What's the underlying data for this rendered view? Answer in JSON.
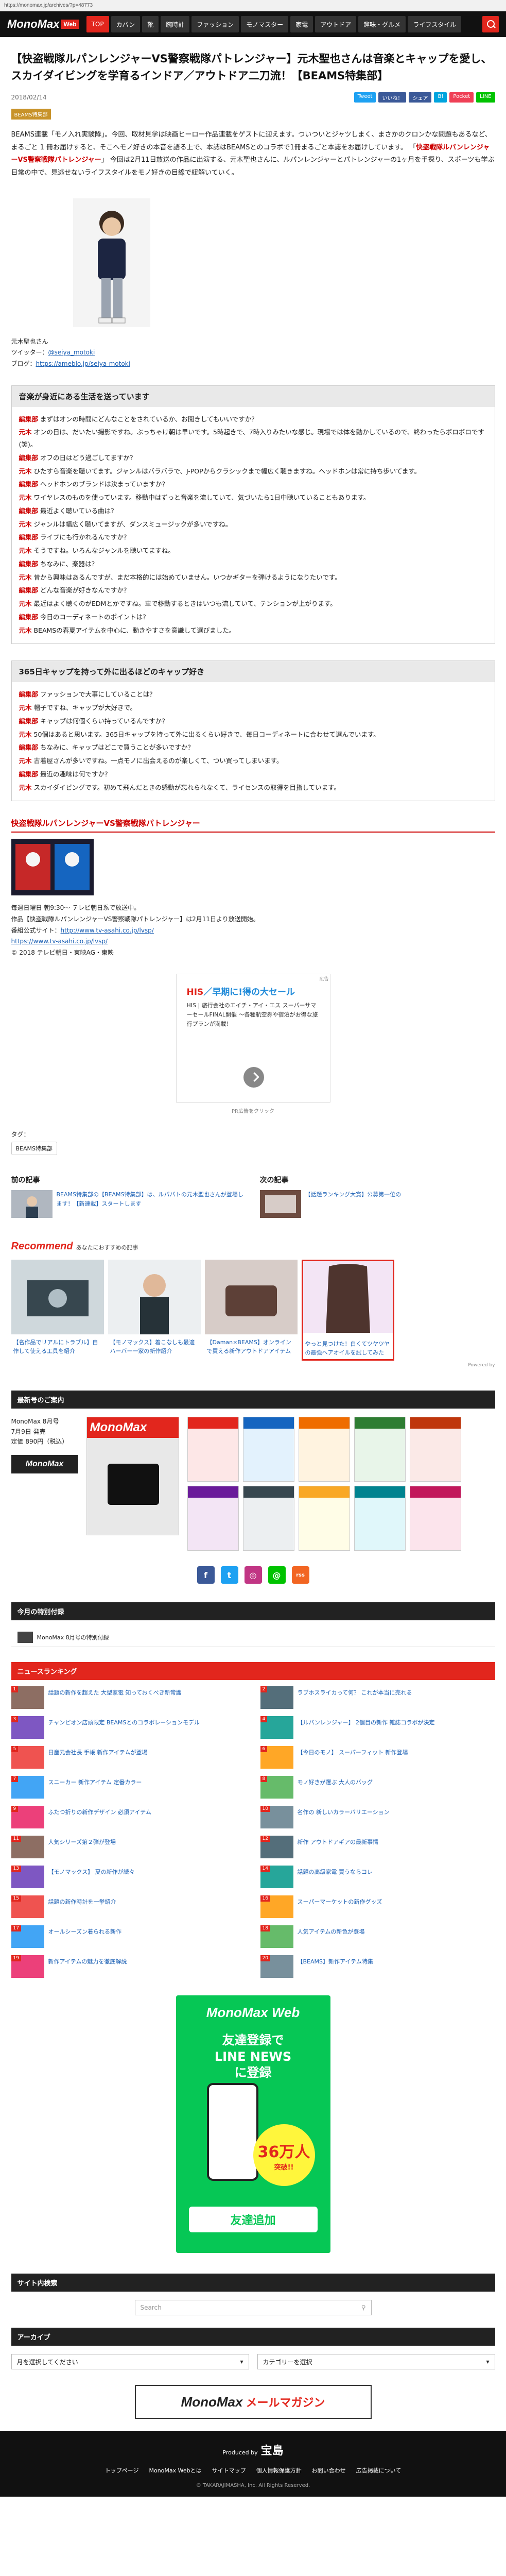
{
  "browser": {
    "url": "https://monomax.jp/archives/?p=48773"
  },
  "nav": {
    "logo": "MonoMax",
    "logo_web": "Web",
    "items": [
      "TOP",
      "カバン",
      "靴",
      "腕時計",
      "ファッション",
      "モノマスター",
      "家電",
      "アウトドア",
      "趣味・グルメ",
      "ライフスタイル"
    ]
  },
  "article": {
    "title": "【快盗戦隊ルパンレンジャーVS警察戦隊パトレンジャー】元木聖也さんは音楽とキャップを愛し、スカイダイビングを学育るインドア／アウトドア二刀流！【BEAMS特集部】",
    "date": "2018/02/14",
    "share": [
      "Tweet",
      "いいね！",
      "シェア",
      "B!",
      "Pocket",
      "LINE"
    ],
    "category": "BEAMS特集部",
    "intro": "BEAMS連載「モノ入れ実験隊」。今回、取材見学は映画ヒーロー作品連載をゲストに迎えます。ついついとジャツしまく、まさかのクロンかな問題もあるなど、まるごと 1 冊お届けすると、そこへモノ好きの本音を語る上で、本誌はBEAMSとのコラボで1冊まるごと本誌をお届けしています。",
    "intro_bold": "快盗戦隊ルパンレンジャーVS警察戦隊パトレンジャー",
    "intro2": "今回は2月11日放送の作品に出演する、元木聖也さんに、ルパンレンジャーとパトレンジャーの1ヶ月を手探り、スポーツも学ぶ日常の中で、見逃せないライフスタイルをモノ好きの目線で紐解いていく。",
    "profile_name": "元木聖也さん",
    "profile_twitter_label": "ツイッター：",
    "profile_twitter": "@seiya_motoki",
    "profile_blog_label": "ブログ：",
    "profile_blog": "https://ameblo.jp/seiya-motoki"
  },
  "section1": {
    "heading": "音楽が身近にある生活を送っています",
    "lines": [
      [
        "編集部",
        "まずはオンの時間にどんなことをされているか、お聞きしてもいいですか？"
      ],
      [
        "元木",
        "オンの日は、だいたい撮影ですね。ぶっちゃけ朝は早いです。5時起きで、7時入りみたいな感じ。現場では体を動かしているので、終わったらボロボロです(笑)。"
      ],
      [
        "編集部",
        "オフの日はどう過ごしてますか？"
      ],
      [
        "元木",
        "ひたすら音楽を聴いてます。ジャンルはバラバラで、J-POPからクラシックまで幅広く聴きますね。ヘッドホンは常に持ち歩いてます。"
      ],
      [
        "編集部",
        "ヘッドホンのブランドは決まっていますか？"
      ],
      [
        "元木",
        "ワイヤレスのものを使っています。移動中はずっと音楽を流していて、気づいたら1日中聴いていることもあります。"
      ],
      [
        "編集部",
        "最近よく聴いている曲は？"
      ],
      [
        "元木",
        "ジャンルは幅広く聴いてますが、ダンスミュージックが多いですね。"
      ],
      [
        "編集部",
        "ライブにも行かれるんですか？"
      ],
      [
        "元木",
        "そうですね。いろんなジャンルを聴いてますね。"
      ],
      [
        "編集部",
        "ちなみに、楽器は？"
      ],
      [
        "元木",
        "昔から興味はあるんですが、まだ本格的には始めていません。いつかギターを弾けるようになりたいです。"
      ],
      [
        "編集部",
        "どんな音楽が好きなんですか？"
      ],
      [
        "元木",
        "最近はよく聴くのがEDMとかですね。車で移動するときはいつも流していて、テンションが上がります。"
      ],
      [
        "編集部",
        "今日のコーディネートのポイントは？"
      ],
      [
        "元木",
        "BEAMSの春夏アイテムを中心に、動きやすさを意識して選びました。"
      ]
    ]
  },
  "section2": {
    "heading": "365日キャップを持って外に出るほどのキャップ好き",
    "lines": [
      [
        "編集部",
        "ファッションで大事にしていることは？"
      ],
      [
        "元木",
        "帽子ですね、キャップが大好きで。"
      ],
      [
        "編集部",
        "キャップは何個くらい持っているんですか？"
      ],
      [
        "元木",
        "50個はあると思います。365日キャップを持って外に出るくらい好きで、毎日コーディネートに合わせて選んでいます。"
      ],
      [
        "編集部",
        "ちなみに、キャップはどこで買うことが多いですか？"
      ],
      [
        "元木",
        "古着屋さんが多いですね。一点モノに出会えるのが楽しくて、つい買ってしまいます。"
      ],
      [
        "編集部",
        "最近の趣味は何ですか？"
      ],
      [
        "元木",
        "スカイダイビングです。初めて飛んだときの感動が忘れられなくて、ライセンスの取得を目指しています。"
      ]
    ]
  },
  "vs": {
    "heading": "快盗戦隊ルパンレンジャーVS警察戦隊パトレンジャー",
    "lines": [
      "毎週日曜日 朝9:30～ テレビ朝日系で放送中。",
      "作品【快盗戦隊ルパンレンジャーVS警察戦隊パトレンジャー】は2月11日より放送開始。",
      "番組公式サイト：",
      "https://www.tv-asahi.co.jp/lvsp/",
      "© 2018 テレビ朝日・東映AG・東映"
    ],
    "site_link": "http://www.tv-asahi.co.jp/lvsp/"
  },
  "ad": {
    "label": "広告",
    "title1": "HIS",
    "title2": "／早期に!得の大セール",
    "sub": "HIS | 旅行会社のエイチ・アイ・エス スーパーサマーセールFINAL開催 ～各種航空券や宿泊がお得な旅行プランが満載！",
    "note": "PR広告をクリック"
  },
  "tags": {
    "label": "タグ：",
    "items": [
      "BEAMS特集部"
    ]
  },
  "prev_next": {
    "prev_heading": "前の記事",
    "prev_text": "BEAMS特集部の【BEAMS特集部】は、ルパパトの元木聖也さんが登場します！【新連載】スタートします",
    "next_heading": "次の記事",
    "next_text": "【話題ランキング大賞】公募第一位の"
  },
  "recommend": {
    "heading": "Recommend",
    "sub": "あなたにおすすめの記事",
    "items": [
      "【名作品でリアルにトラブル】自作して使える工具を紹介",
      "【モノマックス】着こなしも最適 ハーバー一家の新作紹介",
      "【Daman×BEAMS】オンラインで買える新作アウトドアアイテム",
      "やっと見つけた！白くてツヤツヤの最強ヘアオイルを試してみた"
    ],
    "powered": "Powered by"
  },
  "books": {
    "heading": "最新号のご案内",
    "magazine": "MonoMax",
    "issue": "MonoMax 8月号",
    "date": "7月9日 発売",
    "price": "定価 890円（税込）",
    "logo_sm": "MonoMax"
  },
  "sns": [
    "f",
    "t",
    "◎",
    "@",
    "rss"
  ],
  "today": {
    "heading": "今月の特別付録",
    "item": "MonoMax 8月号の特別付録"
  },
  "ranking": {
    "heading": "ニュースランキング",
    "items": [
      "話題の新作を超えた 大型家電 知っておくべき新常識",
      "ラブホスライカって何？ これが本当に売れる",
      "チャンピオン店頭限定 BEAMSとのコラボレーションモデル",
      "【ルパンレンジャー】 2個目の新作 雑誌コラボが決定",
      "日産元会社長 手帳 新作アイテムが登場",
      "【今日のモノ】 スーパーフィット 新作登場",
      "スニーカー 新作アイテム 定番カラー",
      "モノ好きが選ぶ 大人のバッグ",
      "ふたつ折りの新作デザイン 必須アイテム",
      "名作の 新しいカラーバリエーション",
      "人気シリーズ第２弾が登場",
      "新作 アウトドアギアの最新事情",
      "【モノマックス】 夏の新作が続々",
      "話題の高級家電 買うならコレ",
      "話題の新作時計を一挙紹介",
      "スーパーマーケットの新作グッズ",
      "オールシーズン着られる新作",
      "人気アイテムの新色が登場",
      "新作アイテムの魅力を徹底解説",
      "【BEAMS】新作アイテム特集"
    ]
  },
  "line": {
    "logo": "MonoMax Web",
    "title": "友達登録で\nLINE NEWS\nに登録",
    "circle_big": "36万人",
    "circle_small": "突破!!",
    "btn": "友達追加"
  },
  "site_search": {
    "heading": "サイト内検索",
    "placeholder": "Search"
  },
  "archive": {
    "heading": "アーカイブ",
    "month": "月を選択してください",
    "category": "カテゴリーを選択"
  },
  "mail": {
    "m1": "MonoMax",
    "m2": "メールマガジン"
  },
  "footer": {
    "company_label": "Produced by",
    "company": "宝島",
    "links": [
      "トップページ",
      "MonoMax Webとは",
      "サイトマップ",
      "個人情報保護方針",
      "お問い合わせ",
      "広告掲載について"
    ],
    "copyright": "© TAKARAJIMASHA, Inc. All Rights Reserved."
  },
  "colors": {
    "brand": "#e2261d",
    "dark": "#111111",
    "link": "#1a5fb4"
  }
}
